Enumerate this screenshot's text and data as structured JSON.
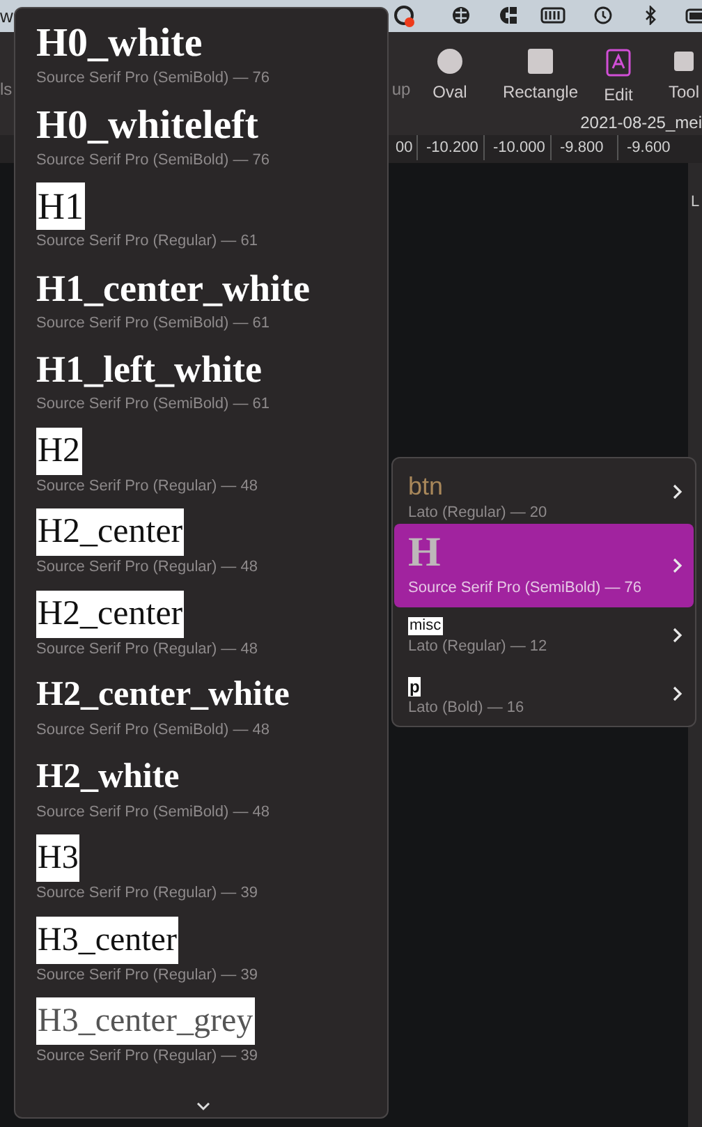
{
  "menu_bar": {
    "text": "w"
  },
  "toolbar": {
    "items": [
      {
        "label": "ls",
        "kind": "text"
      },
      {
        "label": "up",
        "kind": "text"
      },
      {
        "label": "Oval",
        "kind": "oval"
      },
      {
        "label": "Rectangle",
        "kind": "rectangle"
      },
      {
        "label": "Edit",
        "kind": "edit"
      },
      {
        "label": "Tool",
        "kind": "tool"
      }
    ]
  },
  "document_title": "2021-08-25_mei",
  "ruler": {
    "labels": [
      "00",
      "-10.200",
      "-10.000",
      "-9.800",
      "-9.600"
    ]
  },
  "side_panel": {
    "text": "L"
  },
  "style_menu": {
    "items": [
      {
        "name": "H0_white",
        "font": "Source Serif Pro (SemiBold) — 76",
        "kind": "bold0"
      },
      {
        "name": "H0_whiteleft",
        "font": "Source Serif Pro (SemiBold) — 76",
        "kind": "bold0"
      },
      {
        "name": "H1",
        "font": "Source Serif Pro (Regular) — 61",
        "kind": "boxed1"
      },
      {
        "name": "H1_center_white",
        "font": "Source Serif Pro (SemiBold) — 61",
        "kind": "bold1"
      },
      {
        "name": "H1_left_white",
        "font": "Source Serif Pro (SemiBold) — 61",
        "kind": "bold1"
      },
      {
        "name": "H2",
        "font": "Source Serif Pro (Regular) — 48",
        "kind": "boxed2"
      },
      {
        "name": "H2_center",
        "font": "Source Serif Pro (Regular) — 48",
        "kind": "boxed2"
      },
      {
        "name": "H2_center",
        "font": "Source Serif Pro (Regular) — 48",
        "kind": "boxed2"
      },
      {
        "name": "H2_center_white",
        "font": "Source Serif Pro (SemiBold) — 48",
        "kind": "bold2"
      },
      {
        "name": "H2_white",
        "font": "Source Serif Pro (SemiBold) — 48",
        "kind": "bold2"
      },
      {
        "name": "H3",
        "font": "Source Serif Pro (Regular) — 39",
        "kind": "boxed3"
      },
      {
        "name": "H3_center",
        "font": "Source Serif Pro (Regular) — 39",
        "kind": "boxed3"
      },
      {
        "name": "H3_center_grey",
        "font": "Source Serif Pro (Regular) — 39",
        "kind": "boxedgrey3"
      }
    ]
  },
  "submenu": {
    "items": [
      {
        "name": "btn",
        "font": "Lato (Regular) — 20",
        "kind": "accent",
        "selected": false
      },
      {
        "name": "H",
        "font": "Source Serif Pro (SemiBold) — 76",
        "kind": "serif",
        "selected": true
      },
      {
        "name": "misc",
        "font": "Lato (Regular) — 12",
        "kind": "tag",
        "selected": false
      },
      {
        "name": "p",
        "font": "Lato (Bold) — 16",
        "kind": "tag_bold",
        "selected": false
      }
    ]
  }
}
